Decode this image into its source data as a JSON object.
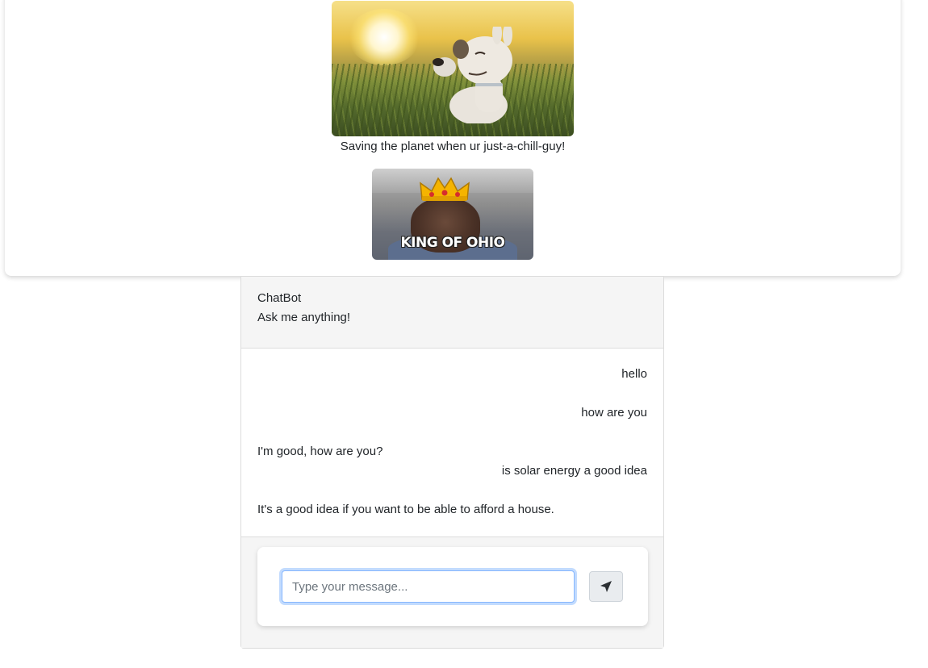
{
  "memes": [
    {
      "caption": "Saving the planet when ur just-a-chill-guy!"
    },
    {
      "overlay_text": "KING OF OHIO"
    }
  ],
  "chat": {
    "header": {
      "title": "ChatBot",
      "subtitle": "Ask me anything!"
    },
    "messages": [
      {
        "sender": "user",
        "text": "hello"
      },
      {
        "sender": "user",
        "text": "how are you"
      },
      {
        "sender": "bot",
        "text": "I'm good, how are you?"
      },
      {
        "sender": "user",
        "text": "is solar energy a good idea"
      },
      {
        "sender": "bot",
        "text": "It's a good idea if you want to be able to afford a house."
      }
    ],
    "input": {
      "placeholder": "Type your message...",
      "value": ""
    },
    "send_icon": "paper-plane-icon"
  },
  "colors": {
    "input_focus_border": "#86b7fe",
    "panel_background": "#f5f5f5",
    "send_button_background": "#e9ecef"
  }
}
